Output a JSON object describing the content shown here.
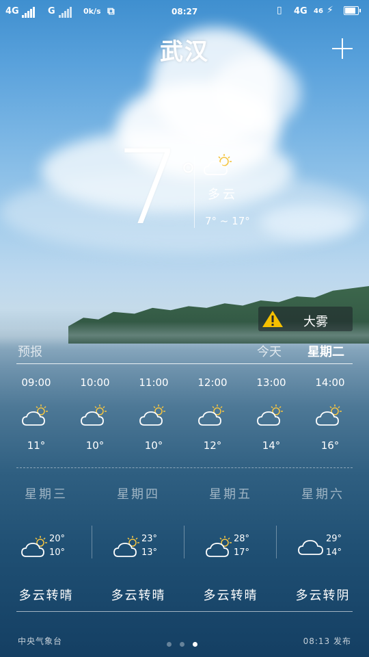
{
  "status_bar": {
    "left_net1": "4G",
    "left_net2": "G",
    "speed": "0k/s",
    "time": "08:27",
    "right_net": "4G",
    "right_net_sub": "46",
    "battery_level": 0.75
  },
  "header": {
    "city": "武汉",
    "add_icon": "plus-icon"
  },
  "current": {
    "temp": "7",
    "degree": "°",
    "condition": "多云",
    "range": "7° ~ 17°",
    "icon": "partly-cloudy-icon"
  },
  "alert": {
    "label": "大雾",
    "icon": "warning-icon",
    "color": "#f5c000"
  },
  "forecast_header": {
    "title": "预报",
    "today": "今天",
    "day": "星期二"
  },
  "hourly": [
    {
      "time": "09:00",
      "temp": "11°",
      "icon": "partly-cloudy-icon"
    },
    {
      "time": "10:00",
      "temp": "10°",
      "icon": "partly-cloudy-icon"
    },
    {
      "time": "11:00",
      "temp": "10°",
      "icon": "partly-cloudy-icon"
    },
    {
      "time": "12:00",
      "temp": "12°",
      "icon": "partly-cloudy-icon"
    },
    {
      "time": "13:00",
      "temp": "14°",
      "icon": "partly-cloudy-icon"
    },
    {
      "time": "14:00",
      "temp": "16°",
      "icon": "partly-cloudy-icon"
    }
  ],
  "daily": [
    {
      "day": "星期三",
      "hi": "20°",
      "lo": "10°",
      "condition": "多云转晴",
      "icon": "partly-cloudy-icon"
    },
    {
      "day": "星期四",
      "hi": "23°",
      "lo": "13°",
      "condition": "多云转晴",
      "icon": "partly-cloudy-icon"
    },
    {
      "day": "星期五",
      "hi": "28°",
      "lo": "17°",
      "condition": "多云转晴",
      "icon": "partly-cloudy-icon"
    },
    {
      "day": "星期六",
      "hi": "29°",
      "lo": "14°",
      "condition": "多云转阴",
      "icon": "cloud-icon"
    }
  ],
  "footer": {
    "source": "中央气象台",
    "published": "08:13 发布",
    "page_count": 3,
    "active_page": 3
  }
}
